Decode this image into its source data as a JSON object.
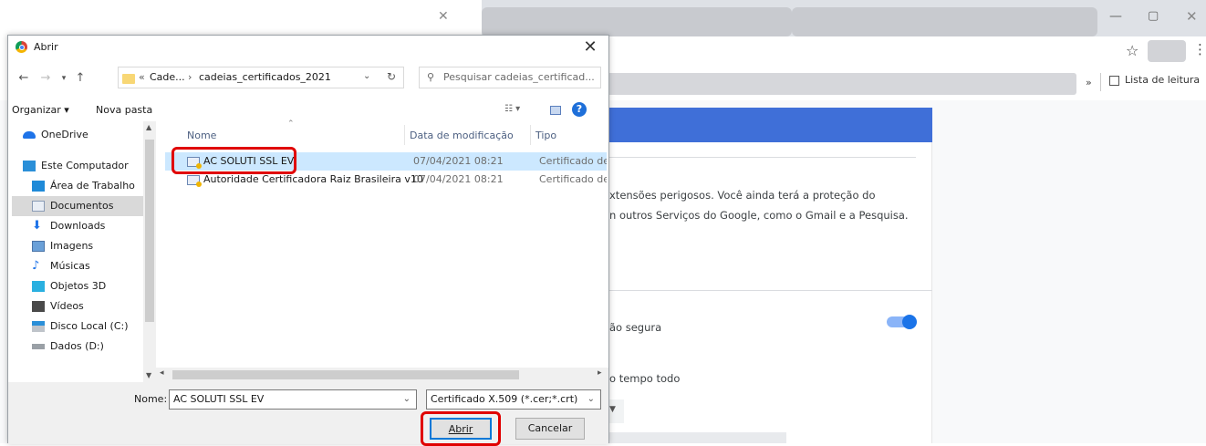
{
  "browser": {
    "bookmarks_more": "»",
    "reading_list": "Lista de leitura",
    "settings": {
      "text_line1": "xtensões perigosos. Você ainda terá a proteção do",
      "text_line2": "n outros Serviços do Google, como o Gmail e a Pesquisa.",
      "toggle_label": "ão segura",
      "always_label": "o tempo todo"
    },
    "colors": {
      "blue_header": "#3f6fd8",
      "toggle": "#1a73e8"
    }
  },
  "dialog": {
    "title": "Abrir",
    "close_glyph": "✕",
    "address": {
      "overflow": "«",
      "crumb1": "Cade...",
      "crumb2": "cadeias_certificados_2021"
    },
    "search_placeholder": "Pesquisar cadeias_certificad...",
    "cmdbar": {
      "organize": "Organizar ▾",
      "new_folder": "Nova pasta"
    },
    "nav_items": [
      {
        "label": "OneDrive",
        "icon": "cloud-icon"
      },
      {
        "label": "Este Computador",
        "icon": "computer-icon"
      },
      {
        "label": "Área de Trabalho",
        "icon": "desktop-icon"
      },
      {
        "label": "Documentos",
        "icon": "documents-icon"
      },
      {
        "label": "Downloads",
        "icon": "downloads-icon"
      },
      {
        "label": "Imagens",
        "icon": "pictures-icon"
      },
      {
        "label": "Músicas",
        "icon": "music-icon"
      },
      {
        "label": "Objetos 3D",
        "icon": "objects3d-icon"
      },
      {
        "label": "Vídeos",
        "icon": "videos-icon"
      },
      {
        "label": "Disco Local (C:)",
        "icon": "disk-icon"
      },
      {
        "label": "Dados (D:)",
        "icon": "drive-icon"
      }
    ],
    "columns": {
      "name": "Nome",
      "modified": "Data de modificação",
      "type": "Tipo"
    },
    "files": [
      {
        "name": "AC SOLUTI SSL EV",
        "modified": "07/04/2021 08:21",
        "type": "Certificado de Se",
        "selected": true
      },
      {
        "name": "Autoridade Certificadora Raiz Brasileira v10",
        "modified": "07/04/2021 08:21",
        "type": "Certificado de Se",
        "selected": false
      }
    ],
    "filename_label": "Nome:",
    "filename_value": "AC SOLUTI SSL EV",
    "filter_value": "Certificado X.509 (*.cer;*.crt)",
    "open_button": "Abrir",
    "cancel_button": "Cancelar"
  }
}
